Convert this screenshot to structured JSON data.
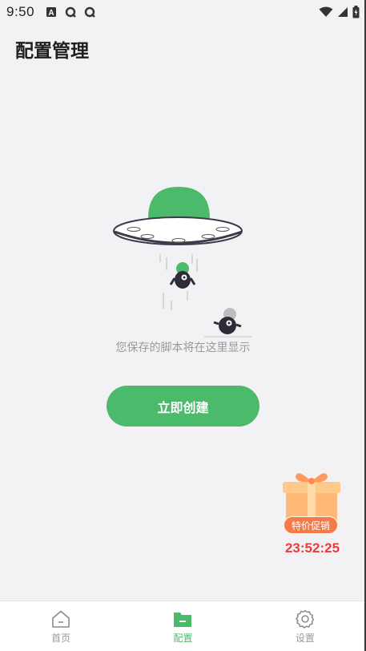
{
  "status_bar": {
    "time": "9:50",
    "left_icons": [
      "a-box-icon",
      "q-circle-icon",
      "q-circle-icon"
    ],
    "right_icons": [
      "wifi-icon",
      "signal-icon",
      "battery-icon"
    ]
  },
  "header": {
    "title": "配置管理"
  },
  "empty_state": {
    "illustration": "ufo-empty-icon",
    "message": "您保存的脚本将在这里显示",
    "create_button_label": "立即创建"
  },
  "promo": {
    "icon": "gift-box-icon",
    "badge_label": "特价促销",
    "countdown": "23:52:25"
  },
  "tabbar": {
    "tabs": [
      {
        "label": "首页",
        "icon": "home-icon",
        "active": false
      },
      {
        "label": "配置",
        "icon": "folder-icon",
        "active": true
      },
      {
        "label": "设置",
        "icon": "gear-icon",
        "active": false
      }
    ]
  },
  "colors": {
    "accent": "#4cba6b",
    "background": "#f2f2f5",
    "timer_red": "#ee3b3b",
    "promo_orange": "#f47a4a"
  }
}
